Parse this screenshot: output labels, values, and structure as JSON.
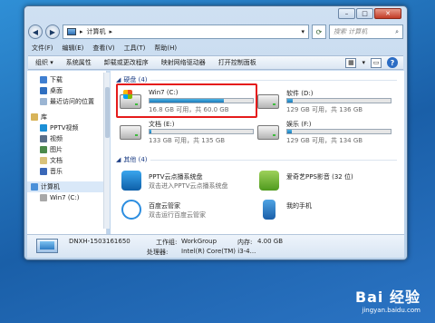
{
  "address": {
    "path": "计算机",
    "search_placeholder": "搜索 计算机"
  },
  "menu": [
    "文件(F)",
    "编辑(E)",
    "查看(V)",
    "工具(T)",
    "帮助(H)"
  ],
  "toolbar": {
    "organize": "组织 ▾",
    "items": [
      "系统属性",
      "卸载或更改程序",
      "映射网络驱动器",
      "打开控制面板"
    ]
  },
  "nav": {
    "fav": [
      "下载",
      "桌面",
      "最近访问的位置"
    ],
    "lib_title": "库",
    "lib": [
      "PPTV视频",
      "视频",
      "图片",
      "文档",
      "音乐"
    ],
    "computer": "计算机",
    "drive": "Win7 (C:)"
  },
  "sections": {
    "hdd": "硬盘 (4)",
    "other": "其他 (4)"
  },
  "drives": [
    {
      "name": "Win7 (C:)",
      "info": "16.8 GB 可用，共 60.0 GB",
      "used": 0.72
    },
    {
      "name": "软件 (D:)",
      "info": "129 GB 可用，共 136 GB",
      "used": 0.05
    },
    {
      "name": "文档 (E:)",
      "info": "133 GB 可用，共 135 GB",
      "used": 0.02
    },
    {
      "name": "娱乐 (F:)",
      "info": "129 GB 可用，共 134 GB",
      "used": 0.04
    }
  ],
  "others": [
    {
      "t1": "PPTV云点播系统盘",
      "t2": "双击进入PPTV云点播系统盘"
    },
    {
      "t1": "爱奇艺PPS影音 (32 位)",
      "t2": ""
    },
    {
      "t1": "百度云管家",
      "t2": "双击运行百度云管家"
    },
    {
      "t1": "我的手机",
      "t2": ""
    }
  ],
  "details": {
    "name": "DNXH-1503161650",
    "wg_k": "工作组:",
    "wg_v": "WorkGroup",
    "mem_k": "内存:",
    "mem_v": "4.00 GB",
    "cpu_k": "处理器:",
    "cpu_v": "Intel(R) Core(TM) i3-4..."
  },
  "watermark": {
    "brand": "Bai 经验",
    "url": "jingyan.baidu.com"
  }
}
